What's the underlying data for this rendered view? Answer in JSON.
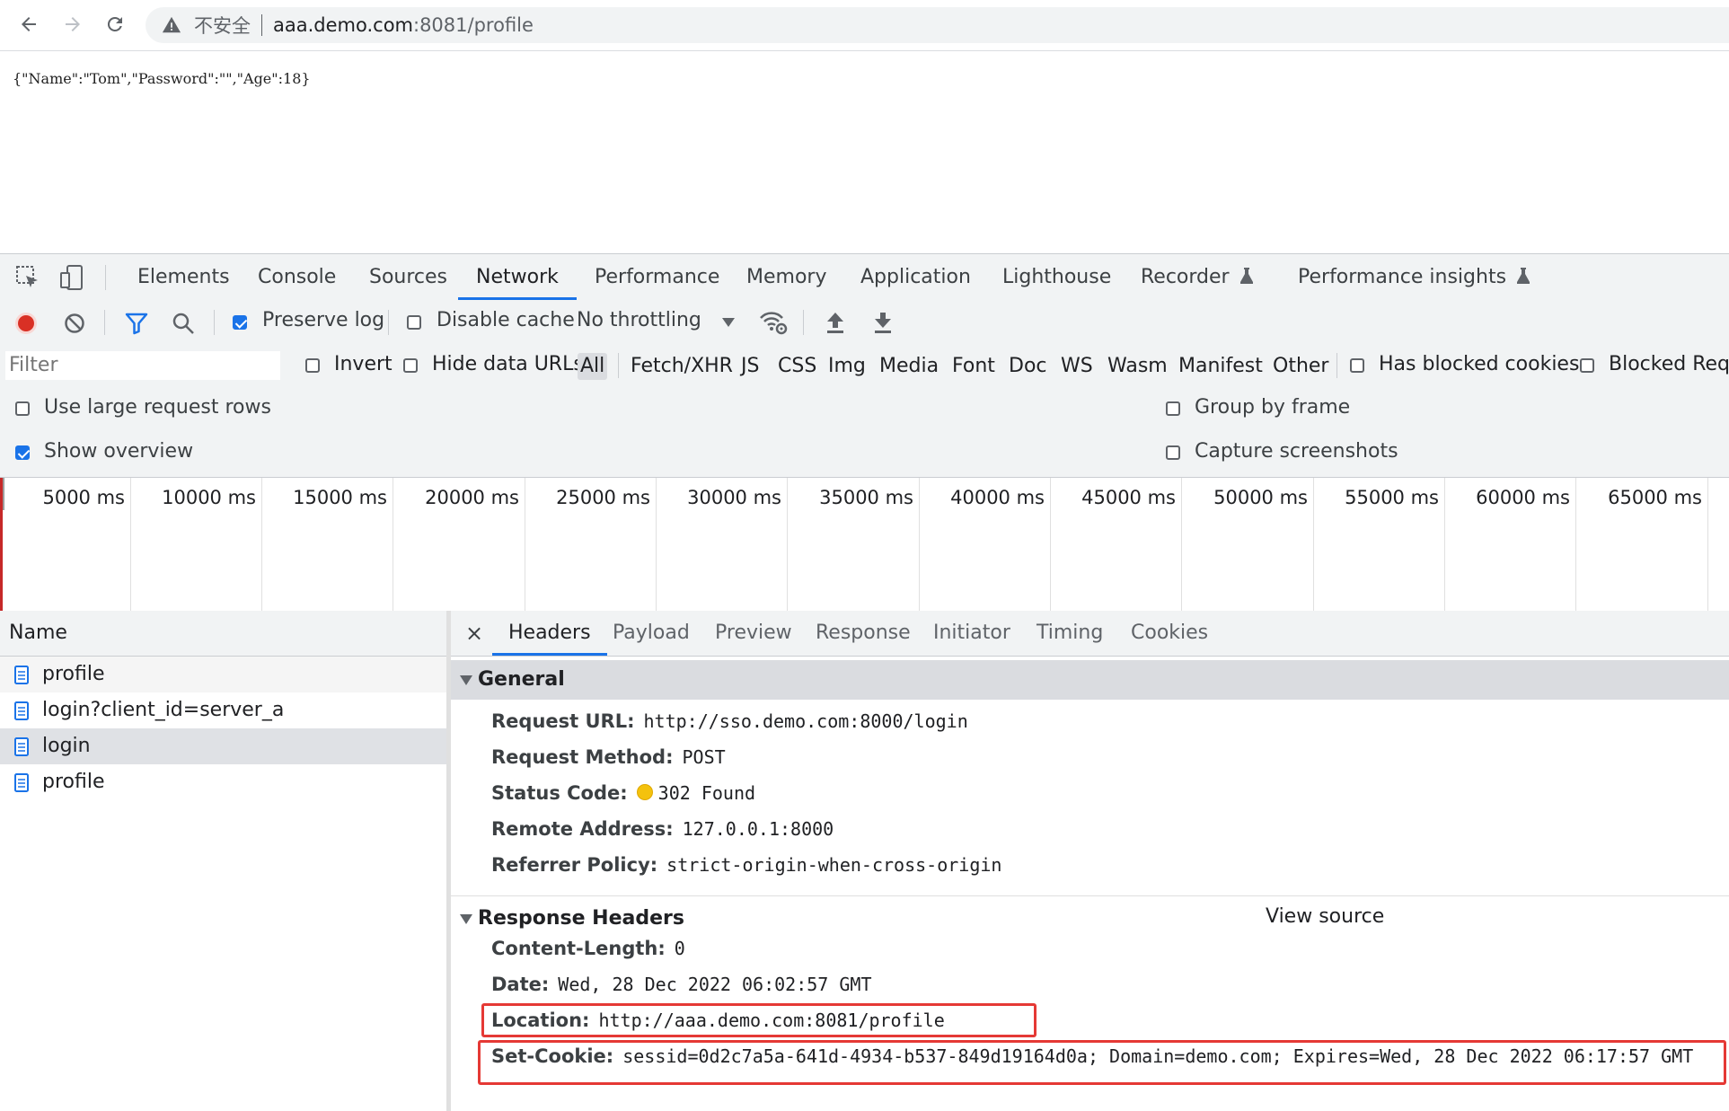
{
  "browser": {
    "security_label": "不安全",
    "url_host": "aaa.demo.com",
    "url_path": ":8081/profile"
  },
  "page": {
    "body_text": "{\"Name\":\"Tom\",\"Password\":\"\",\"Age\":18}"
  },
  "devtools": {
    "tabs": [
      "Elements",
      "Console",
      "Sources",
      "Network",
      "Performance",
      "Memory",
      "Application",
      "Lighthouse",
      "Recorder",
      "Performance insights"
    ],
    "active_tab": "Network",
    "toolbar": {
      "preserve_log": "Preserve log",
      "preserve_log_checked": true,
      "disable_cache": "Disable cache",
      "disable_cache_checked": false,
      "throttling": "No throttling"
    },
    "filter": {
      "placeholder": "Filter",
      "invert": "Invert",
      "hide_data_urls": "Hide data URLs",
      "types": [
        "All",
        "Fetch/XHR",
        "JS",
        "CSS",
        "Img",
        "Media",
        "Font",
        "Doc",
        "WS",
        "Wasm",
        "Manifest",
        "Other"
      ],
      "active_type": "All",
      "has_blocked_cookies": "Has blocked cookies",
      "blocked_requests": "Blocked Requ"
    },
    "options": {
      "large_rows": "Use large request rows",
      "large_rows_checked": false,
      "show_overview": "Show overview",
      "show_overview_checked": true,
      "group_by_frame": "Group by frame",
      "group_by_frame_checked": false,
      "capture_screenshots": "Capture screenshots",
      "capture_screenshots_checked": false
    },
    "overview_ticks": [
      "5000 ms",
      "10000 ms",
      "15000 ms",
      "20000 ms",
      "25000 ms",
      "30000 ms",
      "35000 ms",
      "40000 ms",
      "45000 ms",
      "50000 ms",
      "55000 ms",
      "60000 ms",
      "65000 ms"
    ],
    "requests": {
      "column": "Name",
      "items": [
        "profile",
        "login?client_id=server_a",
        "login",
        "profile"
      ],
      "selected_index": 2
    },
    "detail": {
      "close": "×",
      "tabs": [
        "Headers",
        "Payload",
        "Preview",
        "Response",
        "Initiator",
        "Timing",
        "Cookies"
      ],
      "active_tab": "Headers",
      "general": {
        "title": "General",
        "rows": [
          {
            "key": "Request URL:",
            "value": "http://sso.demo.com:8000/login"
          },
          {
            "key": "Request Method:",
            "value": "POST"
          },
          {
            "key": "Status Code:",
            "value": "302 Found"
          },
          {
            "key": "Remote Address:",
            "value": "127.0.0.1:8000"
          },
          {
            "key": "Referrer Policy:",
            "value": "strict-origin-when-cross-origin"
          }
        ]
      },
      "response_headers": {
        "title": "Response Headers",
        "view_source": "View source",
        "rows": [
          {
            "key": "Content-Length:",
            "value": "0"
          },
          {
            "key": "Date:",
            "value": "Wed, 28 Dec 2022 06:02:57 GMT"
          },
          {
            "key": "Location:",
            "value": "http://aaa.demo.com:8081/profile"
          },
          {
            "key": "Set-Cookie:",
            "value": "sessid=0d2c7a5a-641d-4934-b537-849d19164d0a; Domain=demo.com; Expires=Wed, 28 Dec 2022 06:17:57 GMT"
          }
        ]
      }
    }
  },
  "colors": {
    "accent": "#1a73e8",
    "highlight_box": "#e53935",
    "record": "#d93025",
    "status_dot": "#f4c20d"
  }
}
